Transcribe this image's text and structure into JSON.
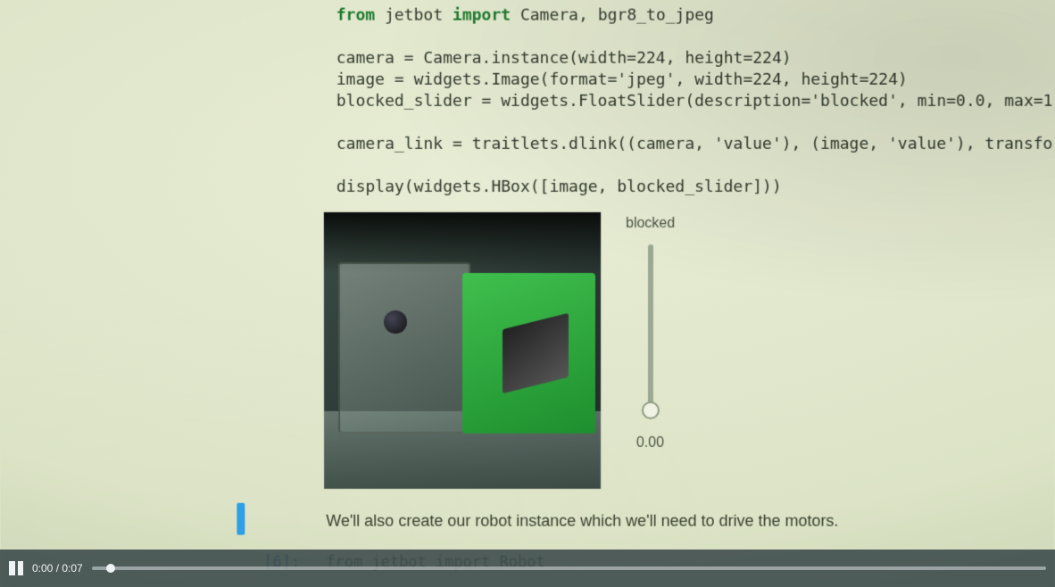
{
  "code": {
    "line1": "from jetbot import Camera, bgr8_to_jpeg",
    "blank1": "",
    "line2": "camera = Camera.instance(width=224, height=224)",
    "line3": "image = widgets.Image(format='jpeg', width=224, height=224)",
    "line4": "blocked_slider = widgets.FloatSlider(description='blocked', min=0.0, max=1",
    "blank2": "",
    "line5": "camera_link = traitlets.dlink((camera, 'value'), (image, 'value'), transfo",
    "blank3": "",
    "line6": "display(widgets.HBox([image, blocked_slider]))"
  },
  "slider": {
    "label": "blocked",
    "value": "0.00"
  },
  "markdown": {
    "text": "We'll also create our robot instance which we'll need to drive the motors."
  },
  "next_cell": {
    "prompt": "[6]:",
    "code": "from jetbot import Robot"
  },
  "video": {
    "current": "0:00",
    "sep": " / ",
    "duration": "0:07"
  }
}
